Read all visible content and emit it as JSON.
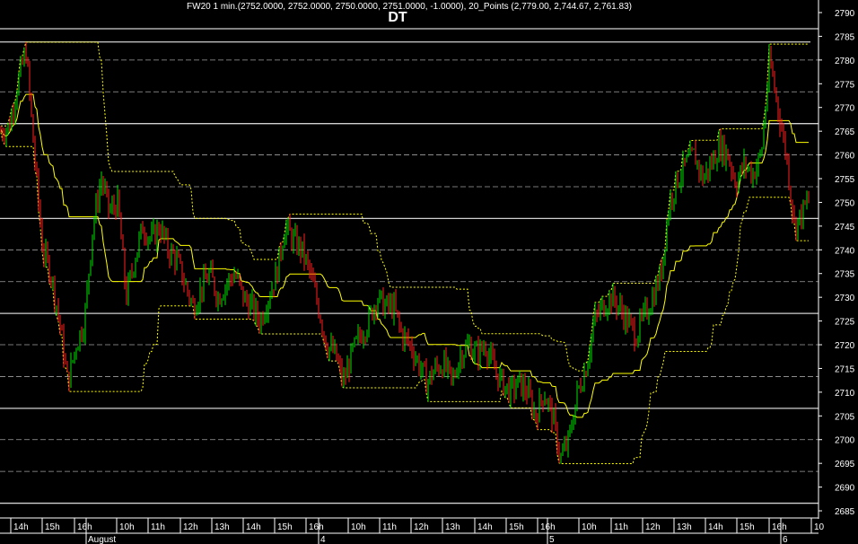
{
  "header": {
    "title": "FW20 1 min.(2752.0000, 2752.0000, 2750.0000, 2751.0000, -1.0000), 20_Points (2,779.00, 2,744.67, 2,761.83)",
    "subtitle": "DT"
  },
  "chart_data": {
    "type": "candlestick",
    "title": "FW20 1 min.",
    "subtitle": "DT",
    "ylim": [
      2683,
      2792
    ],
    "yticks": [
      2685,
      2690,
      2695,
      2700,
      2705,
      2710,
      2715,
      2720,
      2725,
      2730,
      2735,
      2740,
      2745,
      2750,
      2755,
      2760,
      2765,
      2770,
      2775,
      2780,
      2785,
      2790
    ],
    "solid_levels": [
      2786.6,
      2783.8,
      2766.6,
      2746.6,
      2726.6,
      2706.6,
      2686.6
    ],
    "dashed_levels": [
      2780,
      2773.3,
      2760,
      2753.3,
      2740,
      2733.3,
      2720,
      2713.3,
      2700,
      2693.3
    ],
    "xticks": [
      "14h",
      "15h",
      "16h",
      "10h",
      "11h",
      "12h",
      "13h",
      "14h",
      "15h",
      "16h",
      "10h",
      "11h",
      "12h",
      "13h",
      "14h",
      "15h",
      "16h",
      "10h",
      "11h",
      "12h",
      "13h",
      "14h",
      "15h",
      "16h",
      "10"
    ],
    "dates": [
      "August",
      "4",
      "5",
      "6"
    ],
    "price_path": [
      2765,
      2766,
      2775,
      2782,
      2760,
      2740,
      2735,
      2725,
      2712,
      2720,
      2725,
      2745,
      2755,
      2748,
      2750,
      2730,
      2738,
      2745,
      2742,
      2745,
      2740,
      2738,
      2733,
      2728,
      2732,
      2735,
      2730,
      2733,
      2735,
      2730,
      2728,
      2725,
      2730,
      2735,
      2745,
      2742,
      2740,
      2735,
      2728,
      2720,
      2718,
      2712,
      2718,
      2722,
      2725,
      2730,
      2728,
      2728,
      2722,
      2720,
      2716,
      2712,
      2715,
      2716,
      2712,
      2718,
      2720,
      2718,
      2720,
      2715,
      2712,
      2710,
      2712,
      2710,
      2705,
      2710,
      2705,
      2696,
      2700,
      2710,
      2715,
      2725,
      2728,
      2730,
      2728,
      2725,
      2722,
      2726,
      2730,
      2735,
      2750,
      2755,
      2758,
      2760,
      2755,
      2758,
      2762,
      2760,
      2754,
      2758,
      2756,
      2760,
      2780,
      2770,
      2760,
      2745,
      2748,
      2752
    ],
    "indicator": {
      "name": "20_Points",
      "values": [
        2779.0,
        2744.67,
        2761.83
      ]
    },
    "colors": {
      "up": "#00e000",
      "down": "#ff2020",
      "channel": "#ffff00",
      "grid": "#a0a0a0"
    }
  }
}
